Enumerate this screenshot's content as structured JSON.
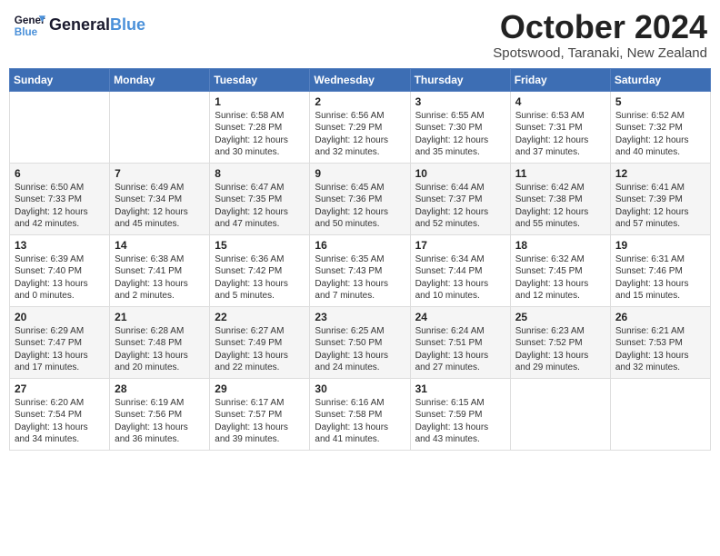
{
  "header": {
    "logo_line1": "General",
    "logo_line2": "Blue",
    "month": "October 2024",
    "location": "Spotswood, Taranaki, New Zealand"
  },
  "days_of_week": [
    "Sunday",
    "Monday",
    "Tuesday",
    "Wednesday",
    "Thursday",
    "Friday",
    "Saturday"
  ],
  "weeks": [
    [
      {
        "day": "",
        "info": ""
      },
      {
        "day": "",
        "info": ""
      },
      {
        "day": "1",
        "info": "Sunrise: 6:58 AM\nSunset: 7:28 PM\nDaylight: 12 hours\nand 30 minutes."
      },
      {
        "day": "2",
        "info": "Sunrise: 6:56 AM\nSunset: 7:29 PM\nDaylight: 12 hours\nand 32 minutes."
      },
      {
        "day": "3",
        "info": "Sunrise: 6:55 AM\nSunset: 7:30 PM\nDaylight: 12 hours\nand 35 minutes."
      },
      {
        "day": "4",
        "info": "Sunrise: 6:53 AM\nSunset: 7:31 PM\nDaylight: 12 hours\nand 37 minutes."
      },
      {
        "day": "5",
        "info": "Sunrise: 6:52 AM\nSunset: 7:32 PM\nDaylight: 12 hours\nand 40 minutes."
      }
    ],
    [
      {
        "day": "6",
        "info": "Sunrise: 6:50 AM\nSunset: 7:33 PM\nDaylight: 12 hours\nand 42 minutes."
      },
      {
        "day": "7",
        "info": "Sunrise: 6:49 AM\nSunset: 7:34 PM\nDaylight: 12 hours\nand 45 minutes."
      },
      {
        "day": "8",
        "info": "Sunrise: 6:47 AM\nSunset: 7:35 PM\nDaylight: 12 hours\nand 47 minutes."
      },
      {
        "day": "9",
        "info": "Sunrise: 6:45 AM\nSunset: 7:36 PM\nDaylight: 12 hours\nand 50 minutes."
      },
      {
        "day": "10",
        "info": "Sunrise: 6:44 AM\nSunset: 7:37 PM\nDaylight: 12 hours\nand 52 minutes."
      },
      {
        "day": "11",
        "info": "Sunrise: 6:42 AM\nSunset: 7:38 PM\nDaylight: 12 hours\nand 55 minutes."
      },
      {
        "day": "12",
        "info": "Sunrise: 6:41 AM\nSunset: 7:39 PM\nDaylight: 12 hours\nand 57 minutes."
      }
    ],
    [
      {
        "day": "13",
        "info": "Sunrise: 6:39 AM\nSunset: 7:40 PM\nDaylight: 13 hours\nand 0 minutes."
      },
      {
        "day": "14",
        "info": "Sunrise: 6:38 AM\nSunset: 7:41 PM\nDaylight: 13 hours\nand 2 minutes."
      },
      {
        "day": "15",
        "info": "Sunrise: 6:36 AM\nSunset: 7:42 PM\nDaylight: 13 hours\nand 5 minutes."
      },
      {
        "day": "16",
        "info": "Sunrise: 6:35 AM\nSunset: 7:43 PM\nDaylight: 13 hours\nand 7 minutes."
      },
      {
        "day": "17",
        "info": "Sunrise: 6:34 AM\nSunset: 7:44 PM\nDaylight: 13 hours\nand 10 minutes."
      },
      {
        "day": "18",
        "info": "Sunrise: 6:32 AM\nSunset: 7:45 PM\nDaylight: 13 hours\nand 12 minutes."
      },
      {
        "day": "19",
        "info": "Sunrise: 6:31 AM\nSunset: 7:46 PM\nDaylight: 13 hours\nand 15 minutes."
      }
    ],
    [
      {
        "day": "20",
        "info": "Sunrise: 6:29 AM\nSunset: 7:47 PM\nDaylight: 13 hours\nand 17 minutes."
      },
      {
        "day": "21",
        "info": "Sunrise: 6:28 AM\nSunset: 7:48 PM\nDaylight: 13 hours\nand 20 minutes."
      },
      {
        "day": "22",
        "info": "Sunrise: 6:27 AM\nSunset: 7:49 PM\nDaylight: 13 hours\nand 22 minutes."
      },
      {
        "day": "23",
        "info": "Sunrise: 6:25 AM\nSunset: 7:50 PM\nDaylight: 13 hours\nand 24 minutes."
      },
      {
        "day": "24",
        "info": "Sunrise: 6:24 AM\nSunset: 7:51 PM\nDaylight: 13 hours\nand 27 minutes."
      },
      {
        "day": "25",
        "info": "Sunrise: 6:23 AM\nSunset: 7:52 PM\nDaylight: 13 hours\nand 29 minutes."
      },
      {
        "day": "26",
        "info": "Sunrise: 6:21 AM\nSunset: 7:53 PM\nDaylight: 13 hours\nand 32 minutes."
      }
    ],
    [
      {
        "day": "27",
        "info": "Sunrise: 6:20 AM\nSunset: 7:54 PM\nDaylight: 13 hours\nand 34 minutes."
      },
      {
        "day": "28",
        "info": "Sunrise: 6:19 AM\nSunset: 7:56 PM\nDaylight: 13 hours\nand 36 minutes."
      },
      {
        "day": "29",
        "info": "Sunrise: 6:17 AM\nSunset: 7:57 PM\nDaylight: 13 hours\nand 39 minutes."
      },
      {
        "day": "30",
        "info": "Sunrise: 6:16 AM\nSunset: 7:58 PM\nDaylight: 13 hours\nand 41 minutes."
      },
      {
        "day": "31",
        "info": "Sunrise: 6:15 AM\nSunset: 7:59 PM\nDaylight: 13 hours\nand 43 minutes."
      },
      {
        "day": "",
        "info": ""
      },
      {
        "day": "",
        "info": ""
      }
    ]
  ]
}
